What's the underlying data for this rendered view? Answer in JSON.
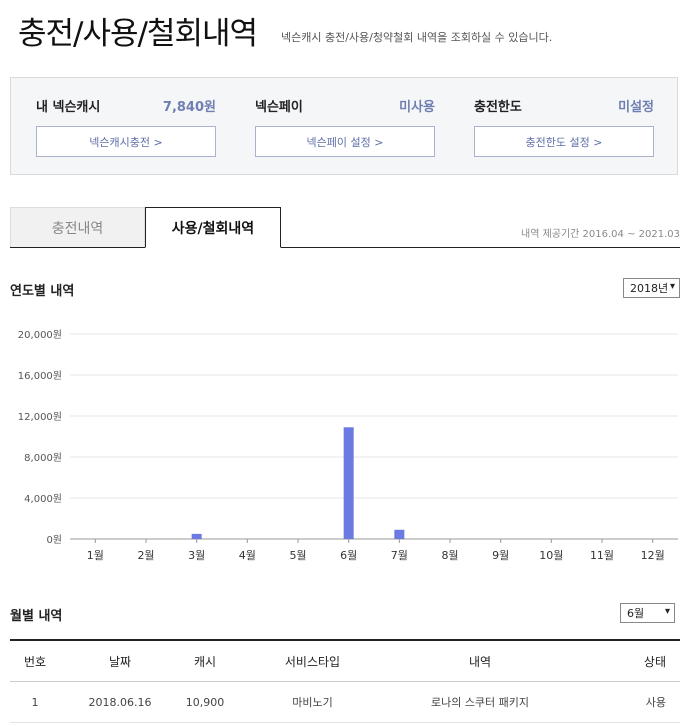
{
  "header": {
    "title": "충전/사용/철회내역",
    "description": "넥슨캐시 충전/사용/청약철회 내역을 조회하실 수 있습니다."
  },
  "summary": [
    {
      "label": "내 넥슨캐시",
      "value": "7,840원",
      "button": "넥슨캐시충전 >"
    },
    {
      "label": "넥슨페이",
      "value": "미사용",
      "button": "넥슨페이 설정 >"
    },
    {
      "label": "충전한도",
      "value": "미설정",
      "button": "충전한도 설정 >"
    }
  ],
  "tabs": [
    {
      "label": "충전내역",
      "active": false
    },
    {
      "label": "사용/철회내역",
      "active": true
    }
  ],
  "period_text": "내역 제공기간 2016.04 ~ 2021.03",
  "yearly": {
    "title": "연도별 내역",
    "selected_year": "2018년"
  },
  "monthly": {
    "title": "월별 내역",
    "selected_month": "6월"
  },
  "chart_data": {
    "type": "bar",
    "categories": [
      "1월",
      "2월",
      "3월",
      "4월",
      "5월",
      "6월",
      "7월",
      "8월",
      "9월",
      "10월",
      "11월",
      "12월"
    ],
    "values": [
      0,
      0,
      500,
      0,
      0,
      10900,
      900,
      0,
      0,
      0,
      0,
      0
    ],
    "ylim": [
      0,
      20000
    ],
    "yticks": [
      0,
      4000,
      8000,
      12000,
      16000,
      20000
    ],
    "ytick_labels": [
      "0원",
      "4,000원",
      "8,000원",
      "12,000원",
      "16,000원",
      "20,000원"
    ],
    "grid": true,
    "bar_color": "#6b79e0"
  },
  "table": {
    "columns": [
      "번호",
      "날짜",
      "캐시",
      "서비스타입",
      "내역",
      "상태"
    ],
    "rows": [
      [
        "1",
        "2018.06.16",
        "10,900",
        "마비노기",
        "로나의 스쿠터 패키지",
        "사용"
      ]
    ]
  }
}
